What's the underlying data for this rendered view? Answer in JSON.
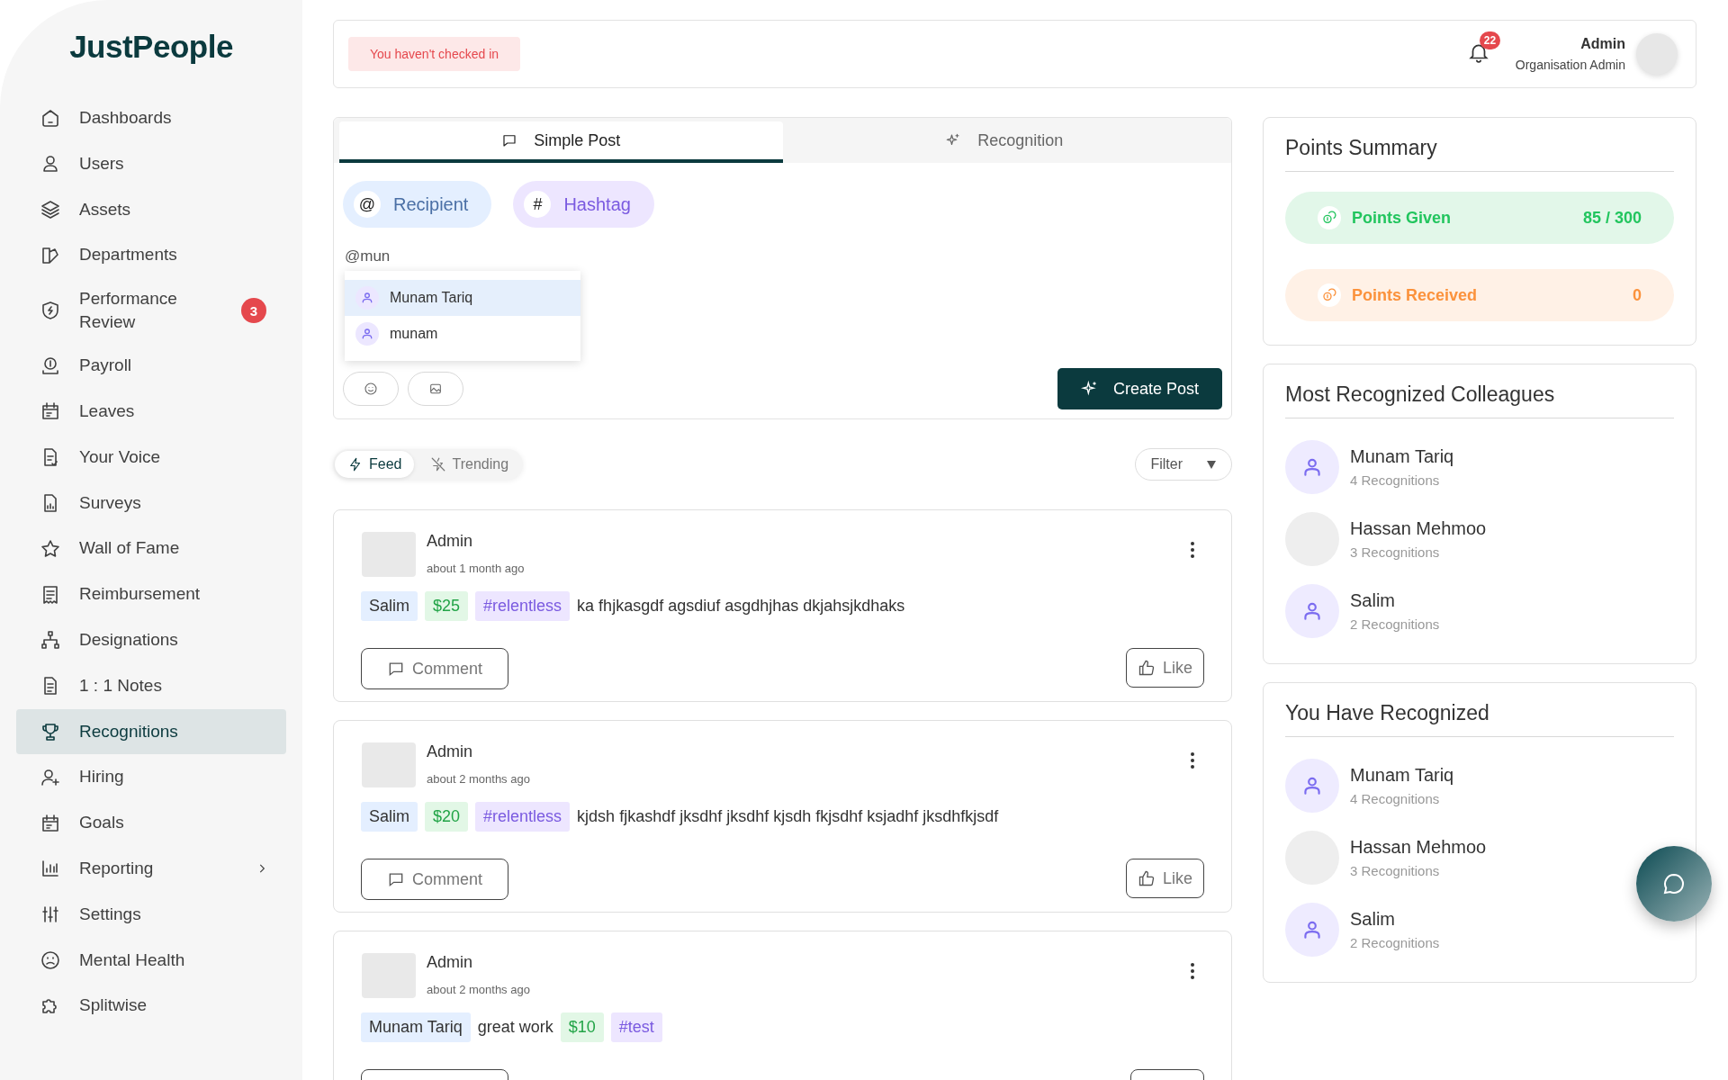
{
  "sidebar": {
    "logo": "JustPeople",
    "items": [
      {
        "label": "Dashboards",
        "selected": false
      },
      {
        "label": "Users",
        "selected": false
      },
      {
        "label": "Assets",
        "selected": false
      },
      {
        "label": "Departments",
        "selected": false
      },
      {
        "label": "Performance Review",
        "selected": false,
        "badge": "3"
      },
      {
        "label": "Payroll",
        "selected": false
      },
      {
        "label": "Leaves",
        "selected": false
      },
      {
        "label": "Your Voice",
        "selected": false
      },
      {
        "label": "Surveys",
        "selected": false
      },
      {
        "label": "Wall of Fame",
        "selected": false
      },
      {
        "label": "Reimbursement",
        "selected": false
      },
      {
        "label": "Designations",
        "selected": false
      },
      {
        "label": "1 : 1 Notes",
        "selected": false
      },
      {
        "label": "Recognitions",
        "selected": true
      },
      {
        "label": "Hiring",
        "selected": false
      },
      {
        "label": "Goals",
        "selected": false
      },
      {
        "label": "Reporting",
        "selected": false,
        "expandable": true
      },
      {
        "label": "Settings",
        "selected": false
      },
      {
        "label": "Mental Health",
        "selected": false
      },
      {
        "label": "Splitwise",
        "selected": false
      }
    ]
  },
  "header": {
    "notice": "You haven't checked in",
    "notifications": "22",
    "user_name": "Admin",
    "user_role": "Organisation Admin"
  },
  "composer": {
    "tabs": [
      {
        "label": "Simple Post",
        "selected": true
      },
      {
        "label": "Recognition",
        "selected": false
      }
    ],
    "chips": [
      {
        "kind": "recipient",
        "symbol": "@",
        "label": "Recipient"
      },
      {
        "kind": "hashtag",
        "symbol": "#",
        "label": "Hashtag"
      }
    ],
    "input": "@mun",
    "suggestions": [
      {
        "name": "Munam Tariq",
        "selected": true
      },
      {
        "name": "munam",
        "selected": false
      }
    ],
    "submit": "Create Post"
  },
  "feed_tabs": [
    {
      "label": "Feed",
      "selected": true
    },
    {
      "label": "Trending",
      "selected": false
    }
  ],
  "filter": "Filter",
  "posts": [
    {
      "author": "Admin",
      "time": "about 1 month ago",
      "segments": [
        {
          "kind": "recipient",
          "text": "Salim"
        },
        {
          "kind": "amount",
          "text": "$25"
        },
        {
          "kind": "hashtag",
          "text": "#relentless"
        },
        {
          "kind": "text",
          "text": "ka fhjkasgdf agsdiuf asgdhjhas dkjahsjkdhaks"
        }
      ],
      "comment": "Comment",
      "like": "Like"
    },
    {
      "author": "Admin",
      "time": "about 2 months ago",
      "segments": [
        {
          "kind": "recipient",
          "text": "Salim"
        },
        {
          "kind": "amount",
          "text": "$20"
        },
        {
          "kind": "hashtag",
          "text": "#relentless"
        },
        {
          "kind": "text",
          "text": "kjdsh fjkashdf jksdhf jksdhf kjsdh fkjsdhf ksjadhf jksdhfkjsdf"
        }
      ],
      "comment": "Comment",
      "like": "Like"
    },
    {
      "author": "Admin",
      "time": "about 2 months ago",
      "segments": [
        {
          "kind": "recipient",
          "text": "Munam Tariq"
        },
        {
          "kind": "text",
          "text": "great work"
        },
        {
          "kind": "amount",
          "text": "$10"
        },
        {
          "kind": "hashtag",
          "text": "#test"
        }
      ]
    }
  ],
  "points": {
    "title": "Points Summary",
    "rows": [
      {
        "kind": "given",
        "label": "Points Given",
        "value": "85 / 300"
      },
      {
        "kind": "received",
        "label": "Points Received",
        "value": "0"
      }
    ]
  },
  "most_recognized": {
    "title": "Most Recognized Colleagues",
    "people": [
      {
        "name": "Munam Tariq",
        "count": "4 Recognitions",
        "kind": "icon"
      },
      {
        "name": "Hassan Mehmoo",
        "count": "3 Recognitions",
        "kind": "photo"
      },
      {
        "name": "Salim",
        "count": "2 Recognitions",
        "kind": "icon"
      }
    ]
  },
  "you_recognized": {
    "title": "You Have Recognized",
    "people": [
      {
        "name": "Munam Tariq",
        "count": "4 Recognitions",
        "kind": "icon"
      },
      {
        "name": "Hassan Mehmoo",
        "count": "3 Recognitions",
        "kind": "photo"
      },
      {
        "name": "Salim",
        "count": "2 Recognitions",
        "kind": "icon"
      }
    ]
  }
}
